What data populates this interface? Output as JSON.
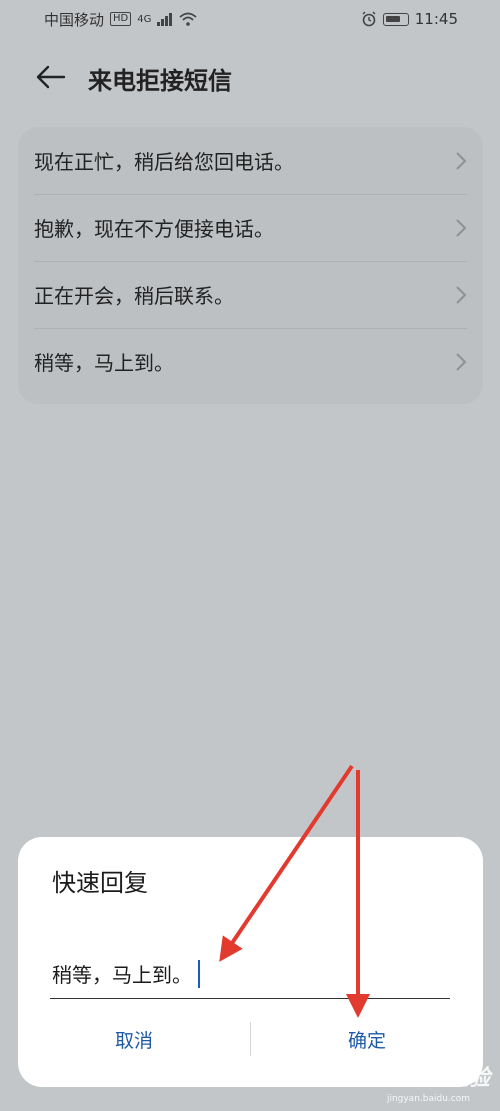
{
  "status_bar": {
    "carrier": "中国移动",
    "hd_badge": "HD",
    "network": "4G",
    "time": "11:45"
  },
  "header": {
    "title": "来电拒接短信",
    "back_icon": "arrow-left-icon"
  },
  "replies": [
    {
      "label": "现在正忙，稍后给您回电话。"
    },
    {
      "label": "抱歉，现在不方便接电话。"
    },
    {
      "label": "正在开会，稍后联系。"
    },
    {
      "label": "稍等，马上到。"
    }
  ],
  "dialog": {
    "title": "快速回复",
    "input_value": "稍等，马上到。",
    "cancel_label": "取消",
    "confirm_label": "确定"
  },
  "watermark": {
    "text": "Baidu 经验",
    "sub": "jingyan.baidu.com"
  },
  "colors": {
    "background": "#c3c6c9",
    "accent": "#1f5aa6",
    "annotation": "#e23a2e"
  }
}
